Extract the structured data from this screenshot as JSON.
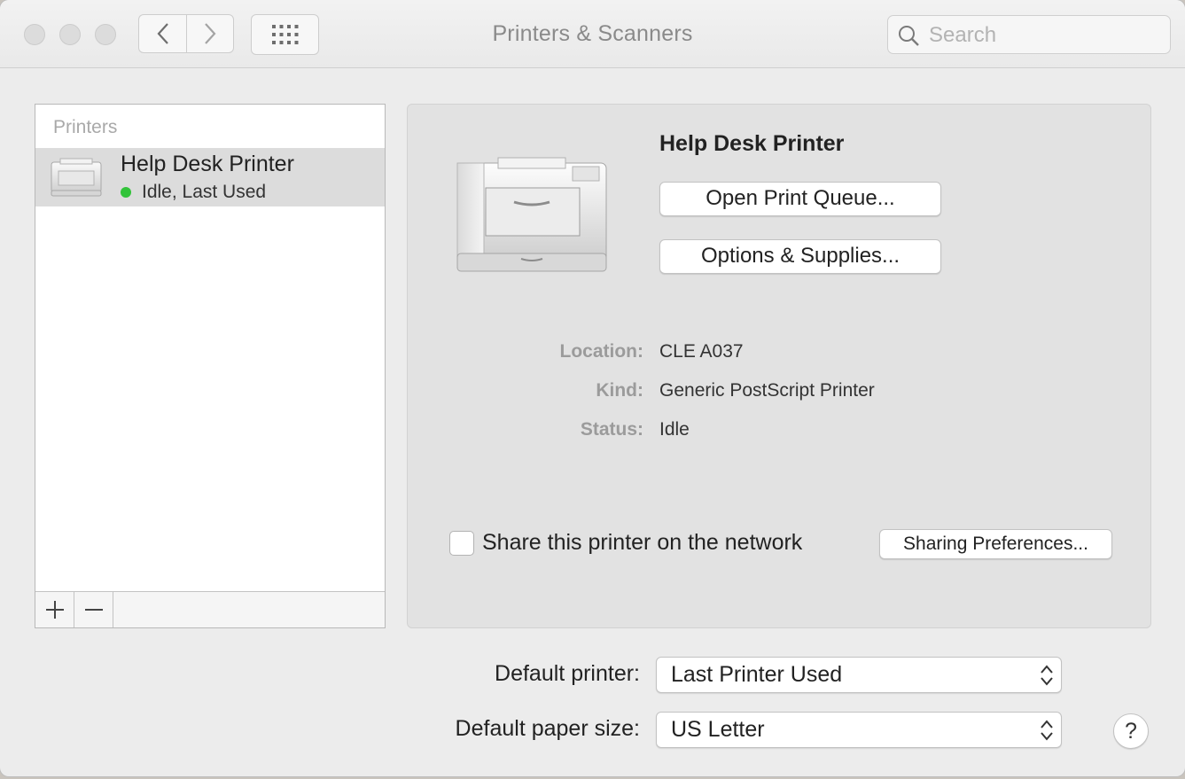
{
  "window": {
    "title": "Printers & Scanners",
    "search_placeholder": "Search"
  },
  "printers_list": {
    "header": "Printers",
    "items": [
      {
        "name": "Help Desk Printer",
        "status": "Idle, Last Used",
        "status_color": "#32c33a"
      }
    ],
    "add_icon": "plus-icon",
    "remove_icon": "minus-icon"
  },
  "detail": {
    "printer_name": "Help Desk Printer",
    "open_queue_label": "Open Print Queue...",
    "options_label": "Options & Supplies...",
    "info": [
      {
        "label": "Location:",
        "value": "CLE A037"
      },
      {
        "label": "Kind:",
        "value": "Generic PostScript Printer"
      },
      {
        "label": "Status:",
        "value": "Idle"
      }
    ],
    "share_label": "Share this printer on the network",
    "share_checked": false,
    "sharing_prefs_label": "Sharing Preferences..."
  },
  "defaults": {
    "printer_label": "Default printer:",
    "printer_value": "Last Printer Used",
    "paper_label": "Default paper size:",
    "paper_value": "US Letter"
  },
  "help_label": "?"
}
